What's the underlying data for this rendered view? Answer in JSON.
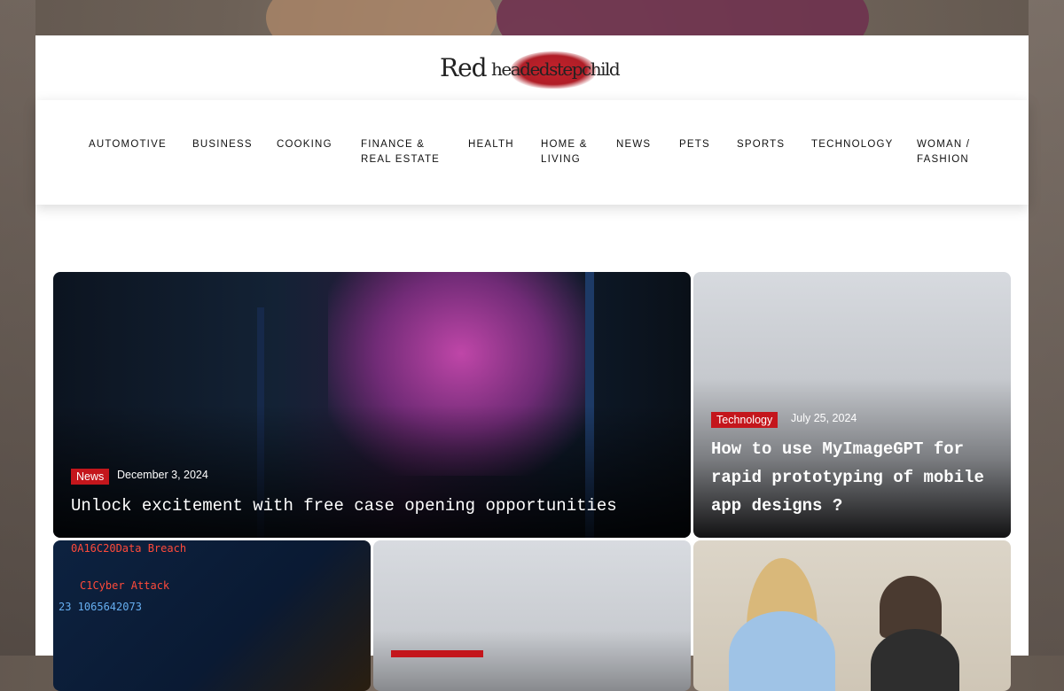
{
  "site": {
    "logo_word1": "Red",
    "logo_word2": "headedstepchild"
  },
  "nav": {
    "items": [
      "AUTOMOTIVE",
      "BUSINESS",
      "COOKING",
      "FINANCE &\nREAL ESTATE",
      "HEALTH",
      "HOME &\nLIVING",
      "NEWS",
      "PETS",
      "SPORTS",
      "TECHNOLOGY",
      "WOMAN /\nFASHION"
    ]
  },
  "featured": [
    {
      "category": "News",
      "date": "December 3, 2024",
      "title": "Unlock excitement with free case opening opportunities"
    },
    {
      "category": "Technology",
      "date": "July 25, 2024",
      "title": "How to use MyImageGPT for rapid prototyping of mobile app designs ?"
    }
  ],
  "thumb_text": {
    "line1": "0A16C20Data Breach",
    "line2": "C1Cyber Attack",
    "line3": "23 1065642073"
  },
  "colors": {
    "accent": "#c4161c",
    "nav_text": "#111111"
  }
}
